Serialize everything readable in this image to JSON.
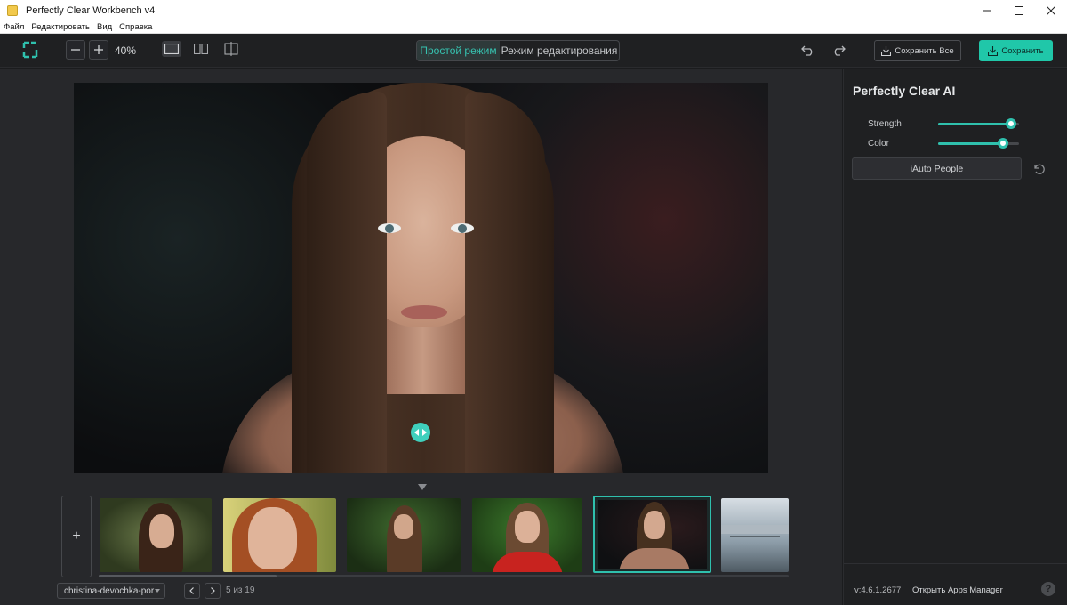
{
  "window": {
    "title": "Perfectly Clear Workbench v4"
  },
  "menu": {
    "items": [
      "Файл",
      "Редактировать",
      "Вид",
      "Справка"
    ]
  },
  "toolbar": {
    "zoom_level": "40%",
    "mode_simple": "Простой режим",
    "mode_edit": "Режим редактирования",
    "save_all_label": "Сохранить Все",
    "save_label": "Сохранить",
    "accent_color": "#20c7a9"
  },
  "filmstrip": {
    "add_label": "+",
    "thumbnails": [
      {
        "name": "thumb-1"
      },
      {
        "name": "thumb-2"
      },
      {
        "name": "thumb-3"
      },
      {
        "name": "thumb-4"
      },
      {
        "name": "thumb-5",
        "selected": true
      },
      {
        "name": "thumb-6"
      }
    ]
  },
  "nav": {
    "file_name": "christina-devochka-por",
    "page_count": "5 из 19"
  },
  "panel": {
    "title": "Perfectly Clear AI",
    "sliders": [
      {
        "label": "Strength",
        "value": 0.9
      },
      {
        "label": "Color",
        "value": 0.8
      }
    ],
    "iauto_label": "iAuto People",
    "version": "v:4.6.1.2677",
    "apps_manager": "Открыть Apps Manager",
    "help_label": "?"
  }
}
